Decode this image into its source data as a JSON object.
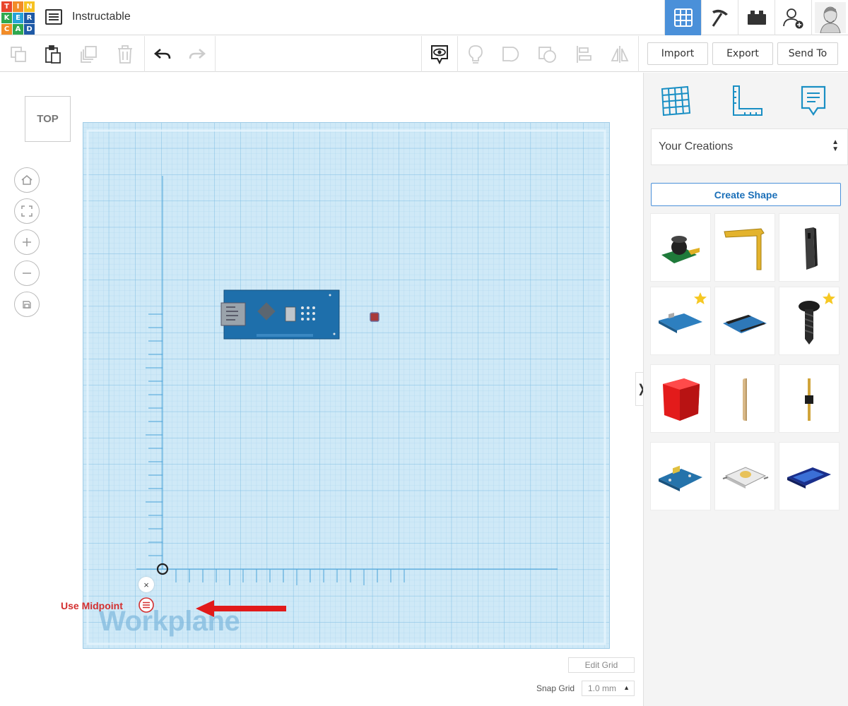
{
  "app": {
    "logo_letters": [
      "T",
      "I",
      "N",
      "K",
      "E",
      "R",
      "C",
      "A",
      "D"
    ],
    "logo_colors": [
      "#e8452c",
      "#f28c28",
      "#f6c223",
      "#2fa84f",
      "#25a2d8",
      "#1f5aa6",
      "#f28c28",
      "#2fa84f",
      "#1f5aa6"
    ],
    "project_title": "Instructable",
    "accent_color": "#4a90d9"
  },
  "topnav": [
    {
      "name": "3d-design-grid-icon",
      "active": true
    },
    {
      "name": "codeblocks-pickaxe-icon",
      "active": false
    },
    {
      "name": "bricks-icon",
      "active": false
    },
    {
      "name": "invite-user-icon",
      "active": false
    },
    {
      "name": "user-avatar",
      "active": false
    }
  ],
  "toolbar": {
    "import_label": "Import",
    "export_label": "Export",
    "sendto_label": "Send To"
  },
  "viewport": {
    "view_cube_label": "TOP",
    "workplane_label": "Workplane",
    "close_symbol": "×",
    "use_midpoint_label": "Use Midpoint",
    "edit_grid_label": "Edit Grid",
    "snap_grid_label": "Snap Grid",
    "snap_grid_value": "1.0 mm",
    "collapse_symbol": "❭"
  },
  "panel": {
    "dropdown_value": "Your Creations",
    "create_shape_label": "Create Shape",
    "tiles": [
      {
        "name": "buzzer-shape",
        "starred": false
      },
      {
        "name": "bent-pin-shape",
        "starred": false
      },
      {
        "name": "header-socket-shape",
        "starred": false
      },
      {
        "name": "arduino-nano-shape",
        "starred": true
      },
      {
        "name": "breakout-board-shape",
        "starred": false
      },
      {
        "name": "screw-shape",
        "starred": true
      },
      {
        "name": "red-cube-shape",
        "starred": false
      },
      {
        "name": "wooden-peg-shape",
        "starred": false
      },
      {
        "name": "pin-header-shape",
        "starred": false
      },
      {
        "name": "sensor-board-shape",
        "starred": false
      },
      {
        "name": "tactile-switch-shape",
        "starred": false
      },
      {
        "name": "lcd-module-shape",
        "starred": false
      }
    ]
  }
}
